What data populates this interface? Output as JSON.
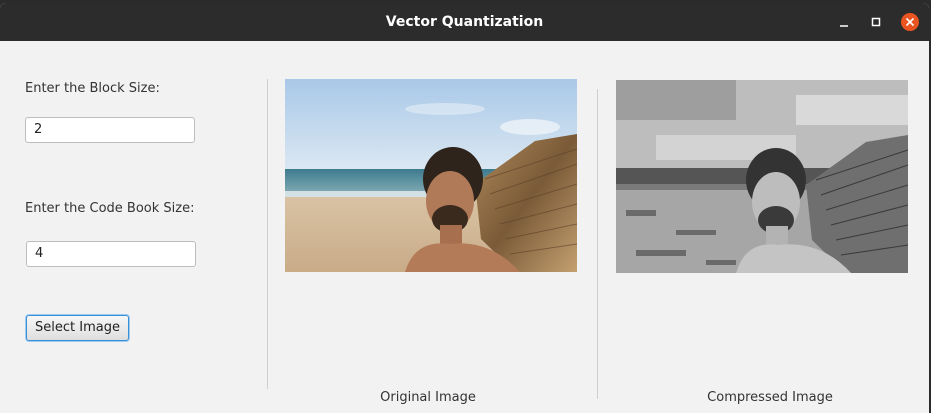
{
  "window": {
    "title": "Vector Quantization",
    "controls": [
      "minimize-icon",
      "maximize-icon",
      "close-icon"
    ],
    "close_color": "#e95420"
  },
  "form": {
    "block_size_label": "Enter the Block Size:",
    "block_size_value": "2",
    "codebook_size_label": "Enter the Code Book Size:",
    "codebook_size_value": "4",
    "select_button_label": "Select Image"
  },
  "images": {
    "original_caption": "Original Image",
    "compressed_caption": "Compressed Image"
  }
}
